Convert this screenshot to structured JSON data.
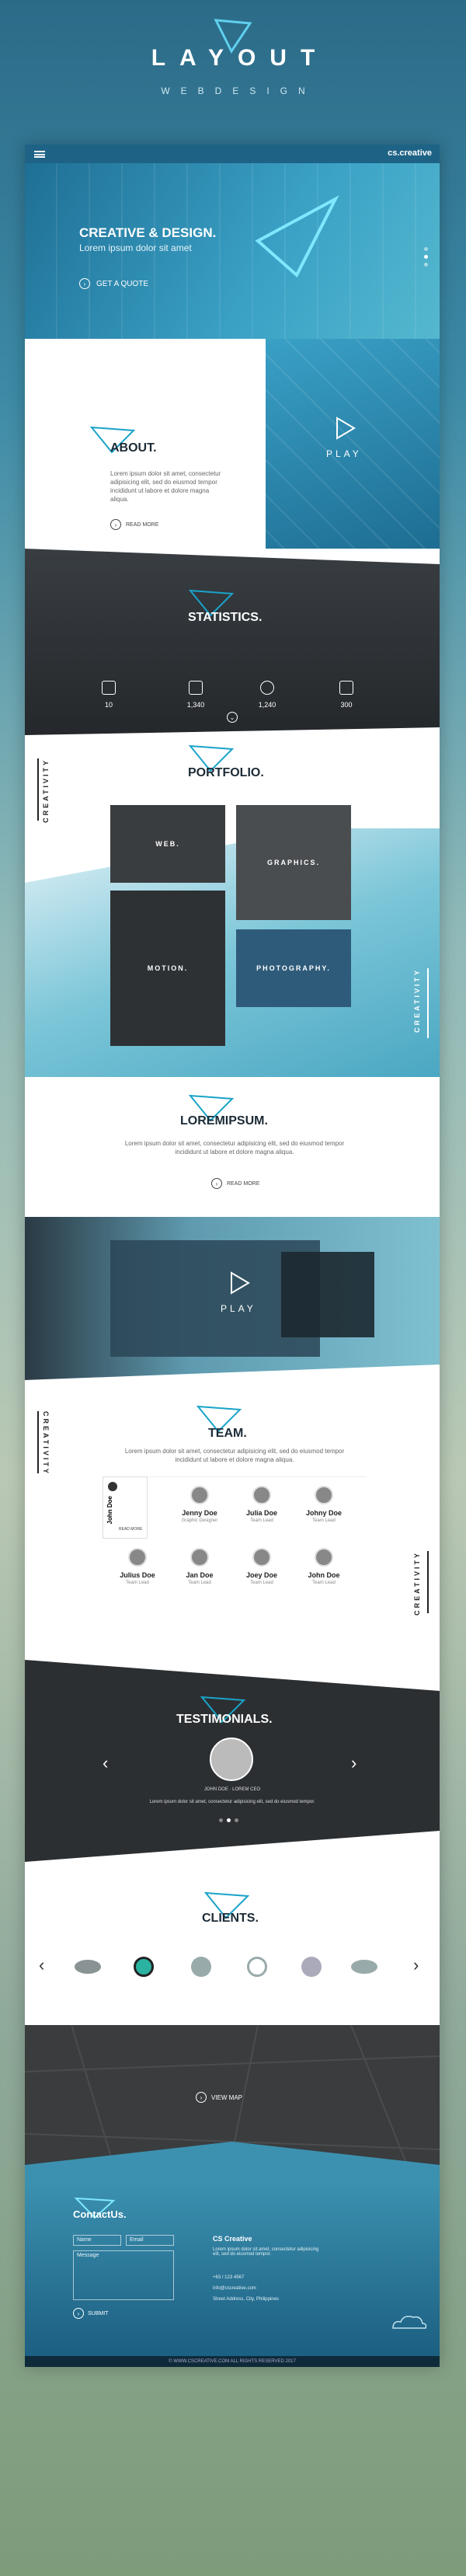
{
  "brand": {
    "title": "LAYOUT",
    "subtitle": "WEBDESIGN"
  },
  "topbar": {
    "tag": "cs.creative"
  },
  "hero": {
    "title": "CREATIVE & DESIGN.",
    "lead": "Lorem ipsum dolor sit amet",
    "cta": "GET A QUOTE"
  },
  "about": {
    "title": "ABOUT.",
    "text": "Lorem ipsum dolor sit amet, consectetur adipisicing elit, sed do eiusmod tempor incididunt ut labore et dolore magna aliqua.",
    "read_more": "READ MORE",
    "play": "PLAY"
  },
  "stats": {
    "title": "STATISTICS.",
    "items": [
      {
        "icon": "camera-icon",
        "value": "10"
      },
      {
        "icon": "pen-icon",
        "value": "1,340"
      },
      {
        "icon": "gear-icon",
        "value": "1,240"
      },
      {
        "icon": "cup-icon",
        "value": "300"
      }
    ]
  },
  "portfolio": {
    "title": "PORTFOLIO.",
    "side_label": "CREATIVITY",
    "tiles": [
      "WEB.",
      "GRAPHICS.",
      "MOTION.",
      "PHOTOGRAPHY."
    ]
  },
  "loremipsum": {
    "title": "LOREMIPSUM.",
    "text": "Lorem ipsum dolor sit amet, consectetur adipisicing elit, sed do eiusmod tempor incididunt ut labore et dolore magna aliqua.",
    "read_more": "READ MORE"
  },
  "video": {
    "play": "PLAY"
  },
  "team": {
    "title": "TEAM.",
    "side_label": "CREATIVITY",
    "text": "Lorem ipsum dolor sit amet, consectetur adipisicing elit, sed do eiusmod tempor incididunt ut labore et dolore magna aliqua.",
    "featured": {
      "name": "John Doe",
      "read_more": "READ MORE"
    },
    "members": [
      {
        "name": "Jenny Doe",
        "role": "Graphic Designer"
      },
      {
        "name": "Julia Doe",
        "role": "Team Lead"
      },
      {
        "name": "Johny Doe",
        "role": "Team Lead"
      },
      {
        "name": "Julius Doe",
        "role": "Team Lead"
      },
      {
        "name": "Jan Doe",
        "role": "Team Lead"
      },
      {
        "name": "Joey Doe",
        "role": "Team Lead"
      },
      {
        "name": "John Doe",
        "role": "Team Lead"
      }
    ]
  },
  "testimonials": {
    "title": "TESTIMONIALS.",
    "author": "JOHN DOE · LOREM CEO",
    "quote": "Lorem ipsum dolor sit amet, consectetur adipisicing elit, sed do eiusmod tempor."
  },
  "clients": {
    "title": "CLIENTS."
  },
  "map": {
    "cta": "VIEW MAP"
  },
  "contact": {
    "title": "ContactUs.",
    "name_ph": "Name",
    "email_ph": "Email",
    "message_ph": "Message",
    "submit": "SUBMIT",
    "company": "CS Creative",
    "about": "Lorem ipsum dolor sit amet, consectetur adipisicing elit, sed do eiusmod tempor.",
    "phone": "+63 / 123 4567",
    "email": "info@cscreative.com",
    "address": "Street Address, City, Philippines"
  },
  "footer": {
    "text": "© WWW.CSCREATIVE.COM ALL RIGHTS RESERVED 2017"
  },
  "colors": {
    "accent": "#1aa3c9",
    "dark": "#2b2f33",
    "blue": "#1e6386"
  }
}
